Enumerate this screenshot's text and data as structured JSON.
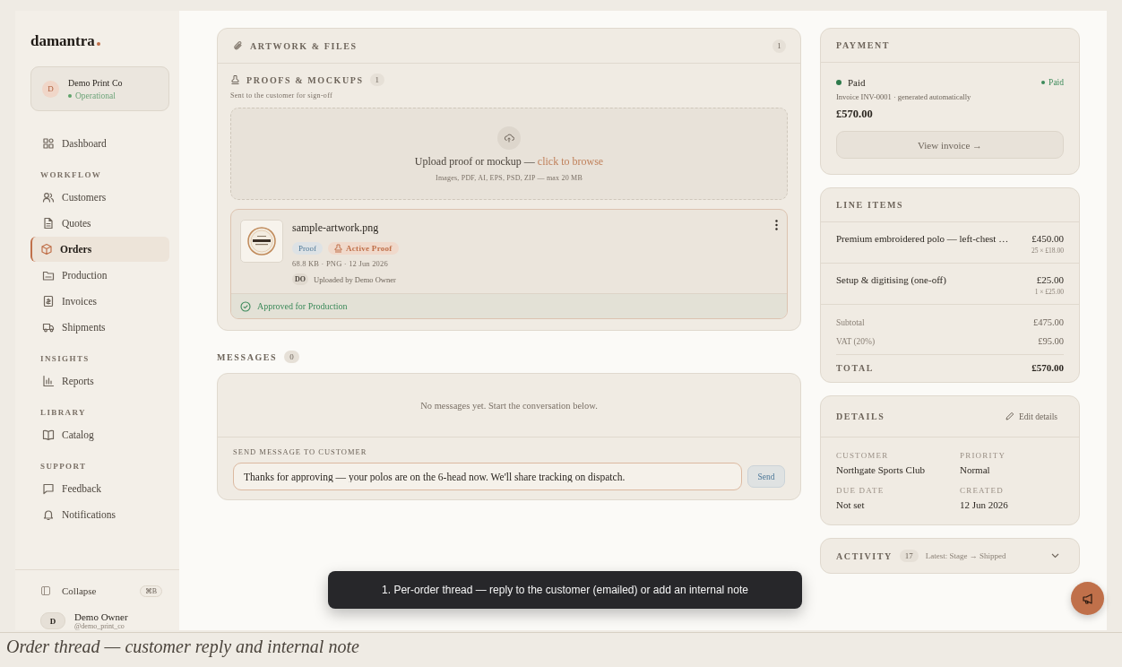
{
  "brand": {
    "name": "damantra"
  },
  "workspace": {
    "avatar": "D",
    "name": "Demo Print Co",
    "status": "Operational"
  },
  "sidebar": {
    "sections": [
      {
        "items": [
          {
            "label": "Dashboard",
            "selected": false
          }
        ]
      },
      {
        "heading": "WORKFLOW",
        "items": [
          {
            "label": "Customers",
            "selected": false
          },
          {
            "label": "Quotes",
            "selected": false
          },
          {
            "label": "Orders",
            "selected": true
          },
          {
            "label": "Production",
            "selected": false
          },
          {
            "label": "Invoices",
            "selected": false
          },
          {
            "label": "Shipments",
            "selected": false
          }
        ]
      },
      {
        "heading": "INSIGHTS",
        "items": [
          {
            "label": "Reports",
            "selected": false
          }
        ]
      },
      {
        "heading": "LIBRARY",
        "items": [
          {
            "label": "Catalog",
            "selected": false
          }
        ]
      },
      {
        "heading": "SUPPORT",
        "items": [
          {
            "label": "Feedback",
            "selected": false
          },
          {
            "label": "Notifications",
            "selected": false
          }
        ]
      }
    ],
    "collapse": {
      "label": "Collapse",
      "shortcut": "⌘B"
    },
    "user": {
      "avatar": "D",
      "name": "Demo Owner",
      "handle": "@demo_print_co"
    }
  },
  "artwork": {
    "title": "ARTWORK & FILES",
    "count": "1",
    "proofs": {
      "title": "PROOFS & MOCKUPS",
      "count": "1",
      "subtitle": "Sent to the customer for sign-off"
    },
    "upload": {
      "text": "Upload proof or mockup — ",
      "link": "click to browse",
      "hint": "Images, PDF, AI, EPS, PSD, ZIP — max 20 MB"
    },
    "file": {
      "name": "sample-artwork.png",
      "tags": [
        {
          "label": "Proof",
          "kind": "type"
        },
        {
          "label": "Active Proof",
          "kind": "active"
        }
      ],
      "meta": "68.8 KB · PNG · 12 Jun 2026",
      "uploader_initials": "DO",
      "uploader": "Uploaded by Demo Owner",
      "status": "Approved for Production"
    }
  },
  "messages": {
    "title": "MESSAGES",
    "count": "0",
    "empty": "No messages yet. Start the conversation below.",
    "compose_label": "SEND MESSAGE TO CUSTOMER",
    "value": "Thanks for approving — your polos are on the 6-head now. We'll share tracking on dispatch.",
    "send": "Send"
  },
  "payment": {
    "title": "PAYMENT",
    "status": "Paid",
    "badge": "Paid",
    "invoice": "Invoice INV-0001 · generated automatically",
    "amount": "£570.00",
    "button": "View invoice →"
  },
  "line_items": {
    "title": "LINE ITEMS",
    "items": [
      {
        "name": "Premium embroidered polo — left-chest …",
        "amount": "£450.00",
        "detail": "25 × £18.00"
      },
      {
        "name": "Setup & digitising (one-off)",
        "amount": "£25.00",
        "detail": "1 × £25.00"
      }
    ],
    "summary": [
      {
        "label": "Subtotal",
        "value": "£475.00"
      },
      {
        "label": "VAT (20%)",
        "value": "£95.00"
      }
    ],
    "total": {
      "label": "TOTAL",
      "value": "£570.00"
    }
  },
  "details": {
    "title": "DETAILS",
    "edit": "Edit details",
    "fields": [
      {
        "label": "CUSTOMER",
        "value": "Northgate Sports Club"
      },
      {
        "label": "PRIORITY",
        "value": "Normal"
      },
      {
        "label": "DUE DATE",
        "value": "Not set"
      },
      {
        "label": "CREATED",
        "value": "12 Jun 2026"
      }
    ]
  },
  "activity": {
    "title": "ACTIVITY",
    "count": "17",
    "latest": "Latest: Stage → Shipped",
    "expanded": false
  },
  "tooltip": {
    "text": "1. Per-order thread — reply to the customer (emailed) or add an internal note"
  },
  "caption": {
    "text": "Order thread — customer reply and internal note"
  }
}
